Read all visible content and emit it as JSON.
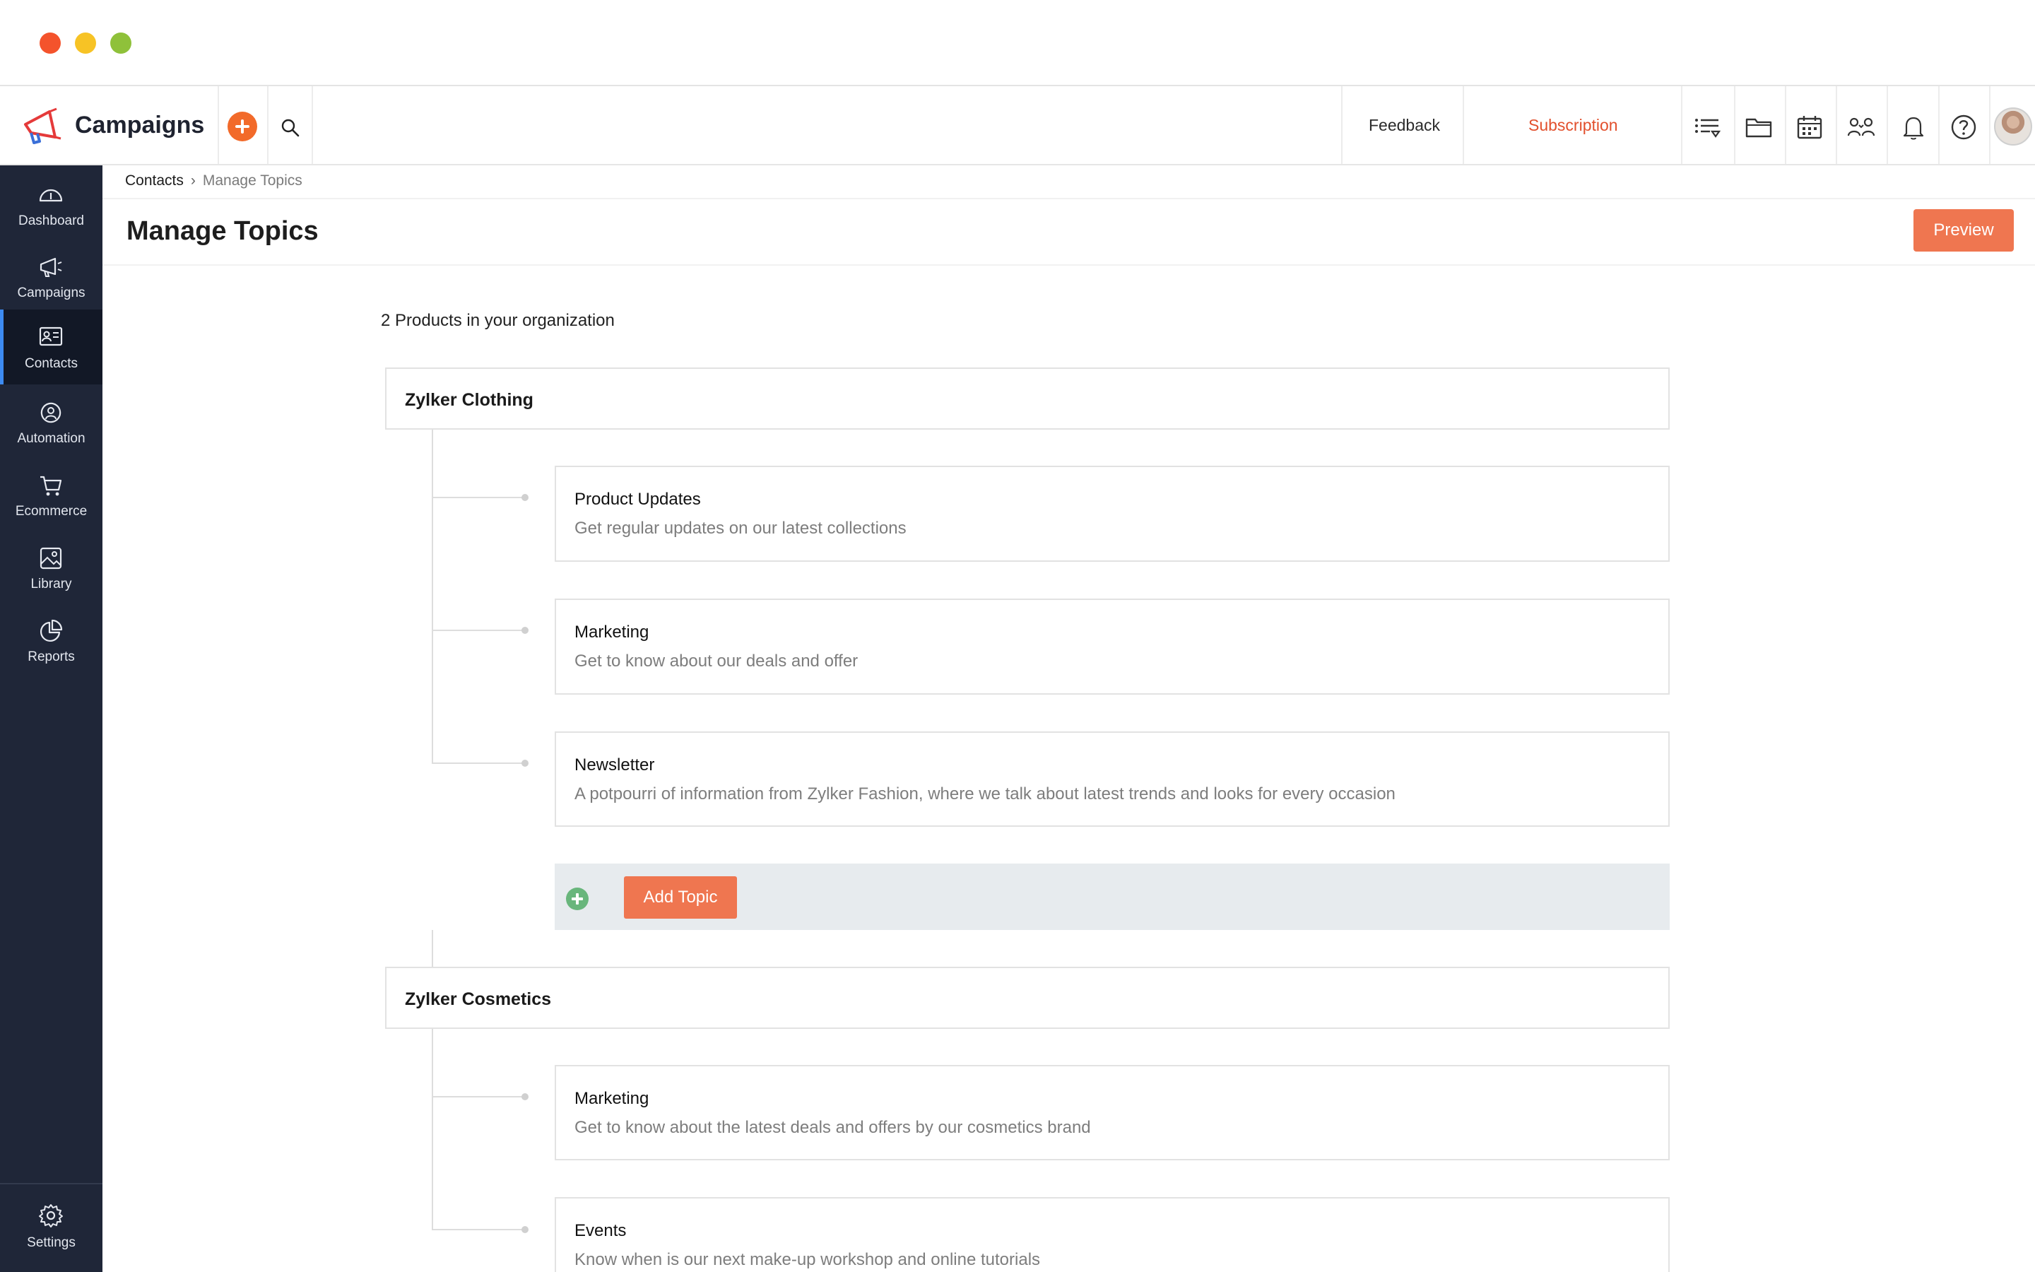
{
  "app": {
    "name": "Campaigns"
  },
  "topbar": {
    "feedback_label": "Feedback",
    "subscription_label": "Subscription",
    "accent_color": "#f26a2a",
    "subscription_color": "#e2502d"
  },
  "sidebar": {
    "items": [
      {
        "label": "Dashboard",
        "icon": "dashboard-icon",
        "active": false
      },
      {
        "label": "Campaigns",
        "icon": "megaphone-icon",
        "active": false
      },
      {
        "label": "Contacts",
        "icon": "contact-card-icon",
        "active": true
      },
      {
        "label": "Automation",
        "icon": "automation-icon",
        "active": false
      },
      {
        "label": "Ecommerce",
        "icon": "cart-icon",
        "active": false
      },
      {
        "label": "Library",
        "icon": "image-library-icon",
        "active": false
      },
      {
        "label": "Reports",
        "icon": "pie-chart-icon",
        "active": false
      }
    ],
    "settings_label": "Settings",
    "bg_color": "#1f2638",
    "active_indicator_color": "#3d8bf2"
  },
  "breadcrumb": {
    "parent": "Contacts",
    "current": "Manage Topics"
  },
  "page": {
    "title": "Manage Topics",
    "preview_label": "Preview",
    "org_summary": "2 Products in your organization"
  },
  "products": [
    {
      "name": "Zylker Clothing",
      "topics": [
        {
          "name": "Product Updates",
          "description": "Get regular updates on our latest collections"
        },
        {
          "name": "Marketing",
          "description": "Get to know about our deals and offer"
        },
        {
          "name": "Newsletter",
          "description": "A potpourri of information from Zylker Fashion, where we talk about latest trends and looks for every occasion"
        }
      ],
      "add_topic_label": "Add Topic"
    },
    {
      "name": "Zylker Cosmetics",
      "topics": [
        {
          "name": "Marketing",
          "description": "Get to know about the latest deals and offers by our cosmetics brand"
        },
        {
          "name": "Events",
          "description": "Know when is our next make-up workshop and online tutorials"
        }
      ]
    }
  ]
}
